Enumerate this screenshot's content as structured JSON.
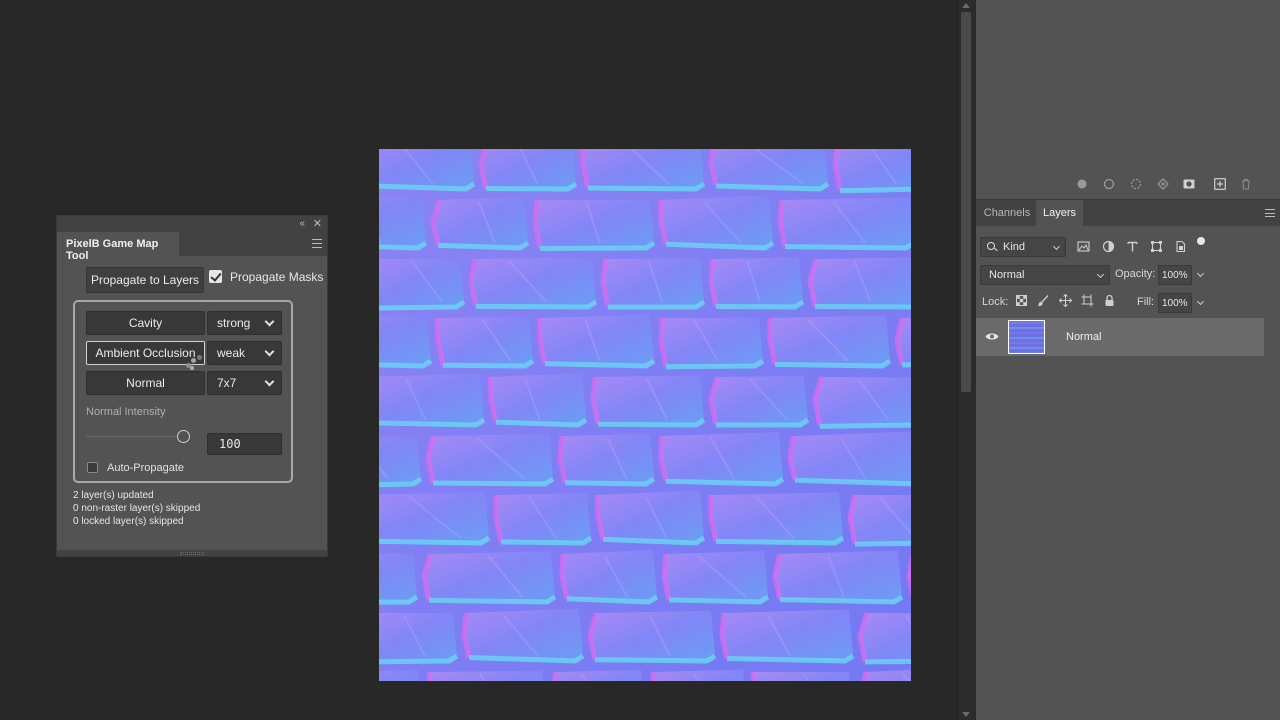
{
  "plugin": {
    "title": "PixelB Game Map Tool",
    "propagate_button": "Propagate to Layers",
    "propagate_masks_label": "Propagate Masks",
    "propagate_masks_checked": true,
    "maps": [
      {
        "button": "Cavity",
        "option": "strong"
      },
      {
        "button": "Ambient Occlusion",
        "option": "weak"
      },
      {
        "button": "Normal",
        "option": "7x7"
      }
    ],
    "normal_intensity_label": "Normal Intensity",
    "normal_intensity_value": "100",
    "auto_propagate_label": "Auto-Propagate",
    "auto_propagate_checked": false,
    "status": [
      "2 layer(s) updated",
      "0 non-raster layer(s) skipped",
      "0 locked layer(s) skipped"
    ]
  },
  "layers_panel": {
    "tabs": [
      {
        "label": "Channels",
        "active": false
      },
      {
        "label": "Layers",
        "active": true
      }
    ],
    "filter_kind": "Kind",
    "blend_mode": "Normal",
    "opacity_label": "Opacity:",
    "opacity_value": "100%",
    "lock_label": "Lock:",
    "fill_label": "Fill:",
    "fill_value": "100%",
    "layers": [
      {
        "name": "Normal",
        "visible": true,
        "selected": true
      }
    ]
  },
  "colors": {
    "normal_map_base": "#7b7ff5",
    "normal_map_pink": "#d86cf0",
    "normal_map_cyan": "#69d6f2",
    "panel_bg": "#535353",
    "app_bg": "#282828"
  }
}
